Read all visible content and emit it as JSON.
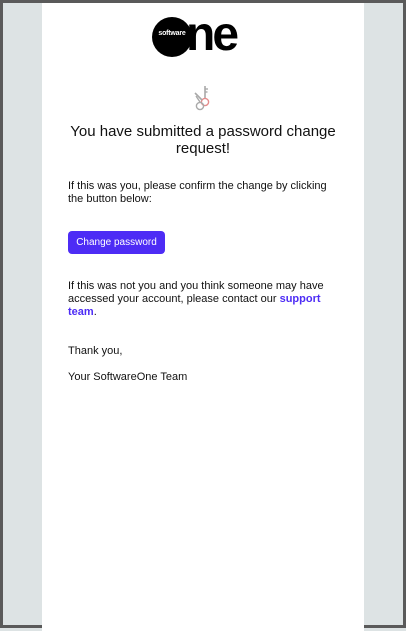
{
  "logo": {
    "small_text": "software",
    "large_text": "ne"
  },
  "icons": {
    "key": "key-icon"
  },
  "heading": "You have submitted a password change request!",
  "confirm_text": "If this was you, please confirm the change by clicking the button below:",
  "button_label": "Change password",
  "not_you_text": "If this was not you and you think someone may have accessed your account, please contact our ",
  "support_link": "support team",
  "not_you_end": ".",
  "thanks": "Thank you,",
  "signature": "Your SoftwareOne Team",
  "colors": {
    "accent": "#4d2cf5",
    "background": "#dde3e4",
    "card": "#ffffff"
  }
}
